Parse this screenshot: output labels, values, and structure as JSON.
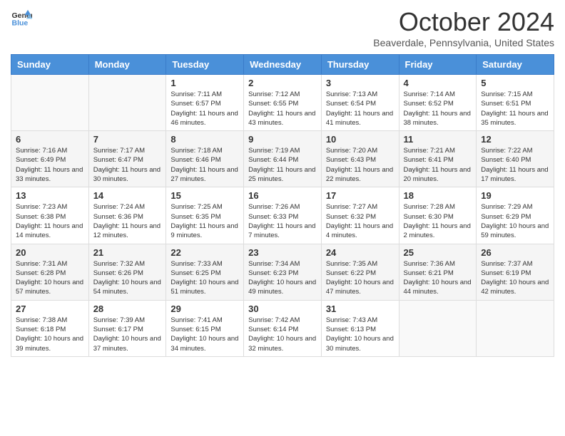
{
  "header": {
    "logo_line1": "General",
    "logo_line2": "Blue",
    "month": "October 2024",
    "location": "Beaverdale, Pennsylvania, United States"
  },
  "weekdays": [
    "Sunday",
    "Monday",
    "Tuesday",
    "Wednesday",
    "Thursday",
    "Friday",
    "Saturday"
  ],
  "weeks": [
    [
      {
        "day": "",
        "info": ""
      },
      {
        "day": "",
        "info": ""
      },
      {
        "day": "1",
        "info": "Sunrise: 7:11 AM\nSunset: 6:57 PM\nDaylight: 11 hours and 46 minutes."
      },
      {
        "day": "2",
        "info": "Sunrise: 7:12 AM\nSunset: 6:55 PM\nDaylight: 11 hours and 43 minutes."
      },
      {
        "day": "3",
        "info": "Sunrise: 7:13 AM\nSunset: 6:54 PM\nDaylight: 11 hours and 41 minutes."
      },
      {
        "day": "4",
        "info": "Sunrise: 7:14 AM\nSunset: 6:52 PM\nDaylight: 11 hours and 38 minutes."
      },
      {
        "day": "5",
        "info": "Sunrise: 7:15 AM\nSunset: 6:51 PM\nDaylight: 11 hours and 35 minutes."
      }
    ],
    [
      {
        "day": "6",
        "info": "Sunrise: 7:16 AM\nSunset: 6:49 PM\nDaylight: 11 hours and 33 minutes."
      },
      {
        "day": "7",
        "info": "Sunrise: 7:17 AM\nSunset: 6:47 PM\nDaylight: 11 hours and 30 minutes."
      },
      {
        "day": "8",
        "info": "Sunrise: 7:18 AM\nSunset: 6:46 PM\nDaylight: 11 hours and 27 minutes."
      },
      {
        "day": "9",
        "info": "Sunrise: 7:19 AM\nSunset: 6:44 PM\nDaylight: 11 hours and 25 minutes."
      },
      {
        "day": "10",
        "info": "Sunrise: 7:20 AM\nSunset: 6:43 PM\nDaylight: 11 hours and 22 minutes."
      },
      {
        "day": "11",
        "info": "Sunrise: 7:21 AM\nSunset: 6:41 PM\nDaylight: 11 hours and 20 minutes."
      },
      {
        "day": "12",
        "info": "Sunrise: 7:22 AM\nSunset: 6:40 PM\nDaylight: 11 hours and 17 minutes."
      }
    ],
    [
      {
        "day": "13",
        "info": "Sunrise: 7:23 AM\nSunset: 6:38 PM\nDaylight: 11 hours and 14 minutes."
      },
      {
        "day": "14",
        "info": "Sunrise: 7:24 AM\nSunset: 6:36 PM\nDaylight: 11 hours and 12 minutes."
      },
      {
        "day": "15",
        "info": "Sunrise: 7:25 AM\nSunset: 6:35 PM\nDaylight: 11 hours and 9 minutes."
      },
      {
        "day": "16",
        "info": "Sunrise: 7:26 AM\nSunset: 6:33 PM\nDaylight: 11 hours and 7 minutes."
      },
      {
        "day": "17",
        "info": "Sunrise: 7:27 AM\nSunset: 6:32 PM\nDaylight: 11 hours and 4 minutes."
      },
      {
        "day": "18",
        "info": "Sunrise: 7:28 AM\nSunset: 6:30 PM\nDaylight: 11 hours and 2 minutes."
      },
      {
        "day": "19",
        "info": "Sunrise: 7:29 AM\nSunset: 6:29 PM\nDaylight: 10 hours and 59 minutes."
      }
    ],
    [
      {
        "day": "20",
        "info": "Sunrise: 7:31 AM\nSunset: 6:28 PM\nDaylight: 10 hours and 57 minutes."
      },
      {
        "day": "21",
        "info": "Sunrise: 7:32 AM\nSunset: 6:26 PM\nDaylight: 10 hours and 54 minutes."
      },
      {
        "day": "22",
        "info": "Sunrise: 7:33 AM\nSunset: 6:25 PM\nDaylight: 10 hours and 51 minutes."
      },
      {
        "day": "23",
        "info": "Sunrise: 7:34 AM\nSunset: 6:23 PM\nDaylight: 10 hours and 49 minutes."
      },
      {
        "day": "24",
        "info": "Sunrise: 7:35 AM\nSunset: 6:22 PM\nDaylight: 10 hours and 47 minutes."
      },
      {
        "day": "25",
        "info": "Sunrise: 7:36 AM\nSunset: 6:21 PM\nDaylight: 10 hours and 44 minutes."
      },
      {
        "day": "26",
        "info": "Sunrise: 7:37 AM\nSunset: 6:19 PM\nDaylight: 10 hours and 42 minutes."
      }
    ],
    [
      {
        "day": "27",
        "info": "Sunrise: 7:38 AM\nSunset: 6:18 PM\nDaylight: 10 hours and 39 minutes."
      },
      {
        "day": "28",
        "info": "Sunrise: 7:39 AM\nSunset: 6:17 PM\nDaylight: 10 hours and 37 minutes."
      },
      {
        "day": "29",
        "info": "Sunrise: 7:41 AM\nSunset: 6:15 PM\nDaylight: 10 hours and 34 minutes."
      },
      {
        "day": "30",
        "info": "Sunrise: 7:42 AM\nSunset: 6:14 PM\nDaylight: 10 hours and 32 minutes."
      },
      {
        "day": "31",
        "info": "Sunrise: 7:43 AM\nSunset: 6:13 PM\nDaylight: 10 hours and 30 minutes."
      },
      {
        "day": "",
        "info": ""
      },
      {
        "day": "",
        "info": ""
      }
    ]
  ]
}
